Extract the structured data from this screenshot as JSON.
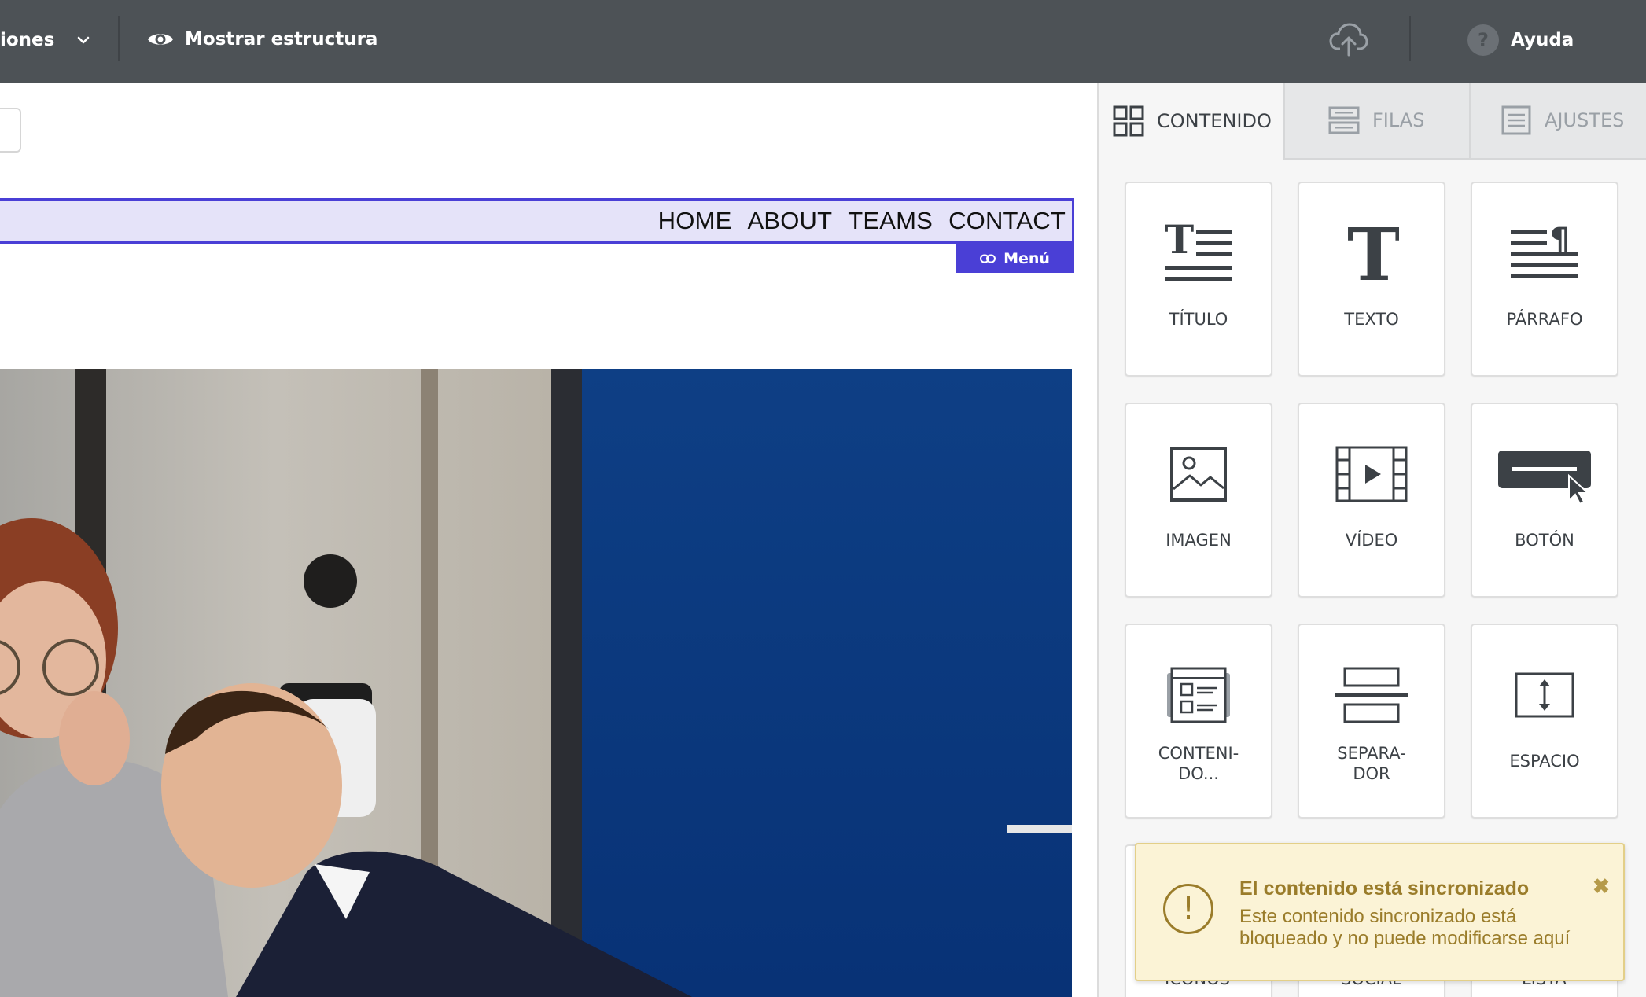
{
  "topbar": {
    "options_label": "iones",
    "structure_label": "Mostrar estructura",
    "help_label": "Ayuda",
    "help_glyph": "?"
  },
  "canvas": {
    "nav_links": [
      "HOME",
      "ABOUT",
      "TEAMS",
      "CONTACT"
    ],
    "menu_tag_label": "Menú"
  },
  "panel": {
    "tabs": [
      {
        "label": "CONTENIDO",
        "icon": "grid-icon",
        "active": true
      },
      {
        "label": "FILAS",
        "icon": "rows-icon",
        "active": false
      },
      {
        "label": "AJUSTES",
        "icon": "settings-doc-icon",
        "active": false
      }
    ],
    "tiles": [
      {
        "label": "TÍTULO",
        "icon": "title-icon"
      },
      {
        "label": "TEXTO",
        "icon": "text-icon"
      },
      {
        "label": "PÁRRAFO",
        "icon": "paragraph-icon"
      },
      {
        "label": "IMAGEN",
        "icon": "image-icon"
      },
      {
        "label": "VÍDEO",
        "icon": "video-icon"
      },
      {
        "label": "BOTÓN",
        "icon": "button-icon"
      },
      {
        "label": "CONTENI-\nDO...",
        "icon": "content-icon"
      },
      {
        "label": "SEPARA-\nDOR",
        "icon": "separator-icon"
      },
      {
        "label": "ESPACIO",
        "icon": "spacer-icon"
      }
    ],
    "peek_labels": [
      "ICONOS",
      "SOCIAL",
      "LISTA"
    ]
  },
  "toast": {
    "title": "El contenido está sincronizado",
    "message": "Este contenido sincronizado está bloqueado y no puede modificarse aquí",
    "close_glyph": "✖",
    "icon_glyph": "!"
  },
  "colors": {
    "topbar": "#4d5256",
    "accent": "#4a3fd6",
    "nav_highlight": "#e5e3f9",
    "toast_bg": "#fbf3d6",
    "toast_text": "#9a7c2a"
  }
}
